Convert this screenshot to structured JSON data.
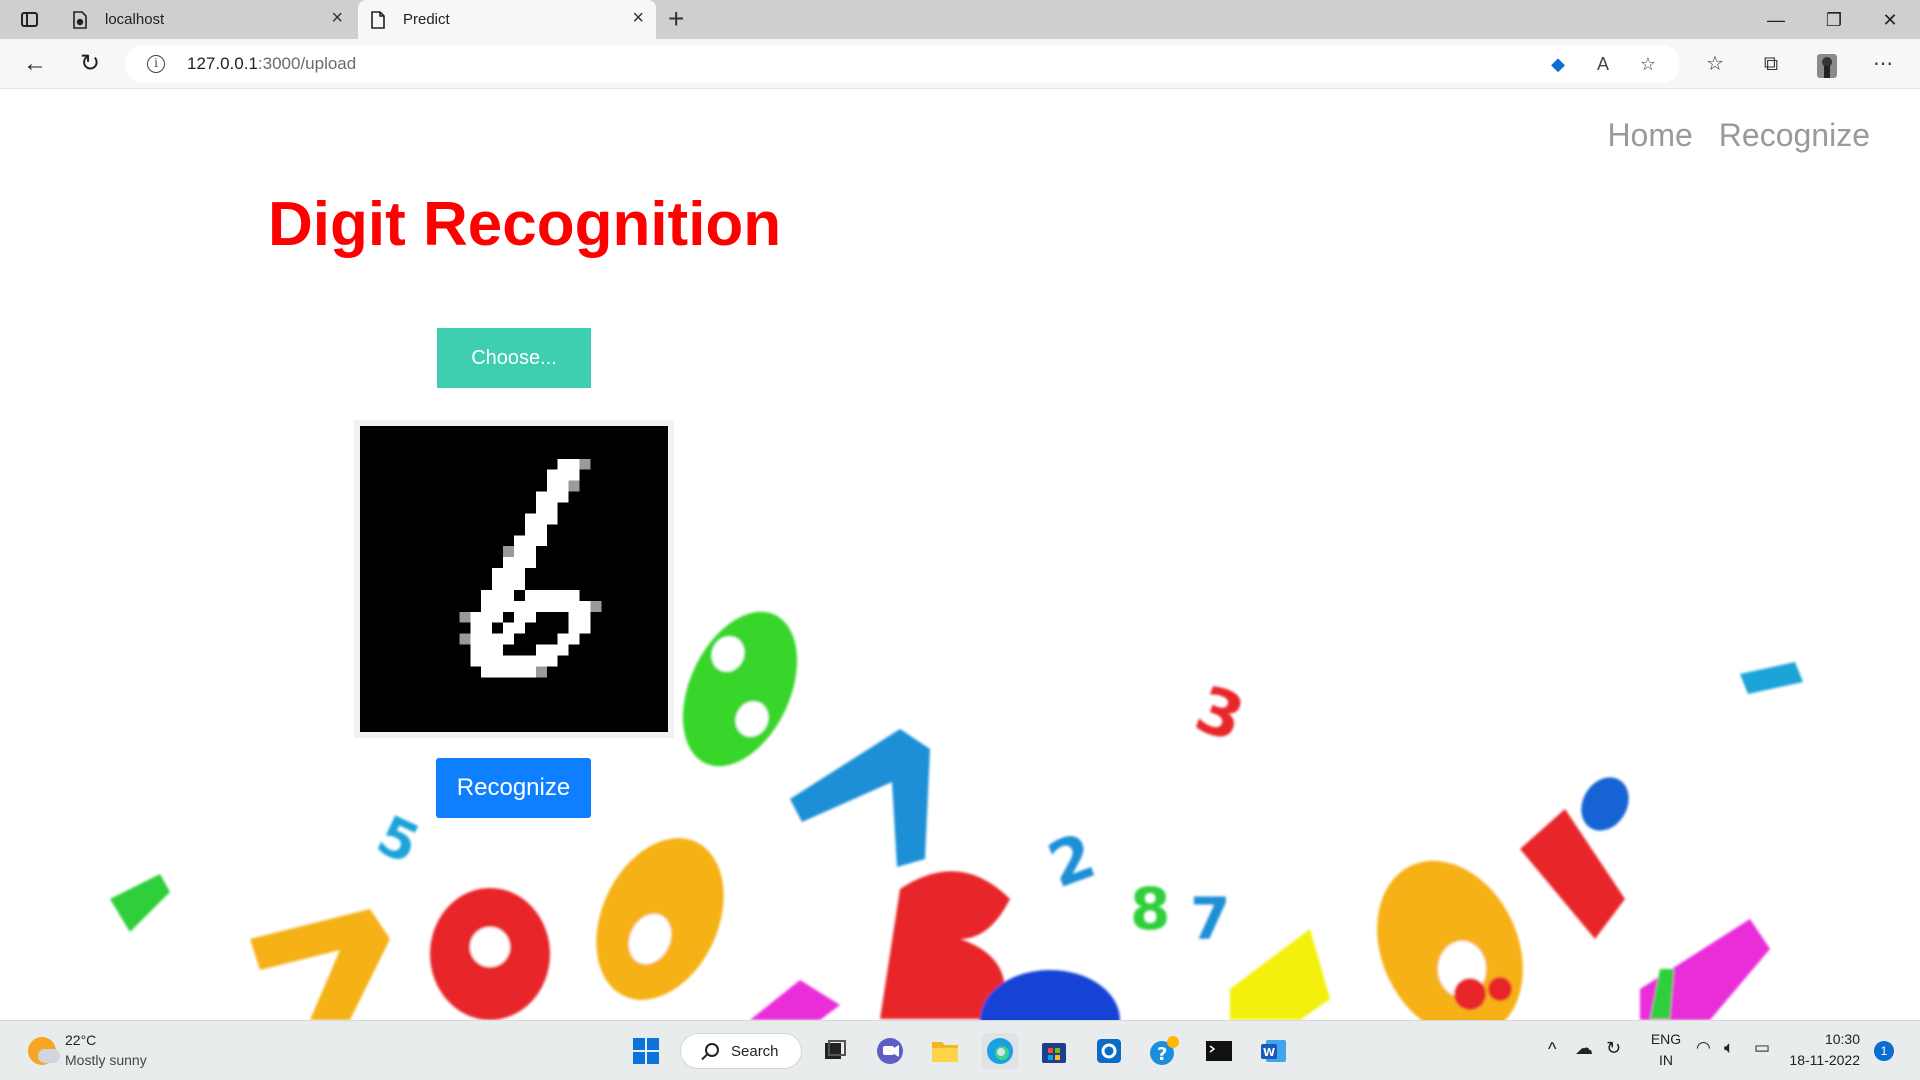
{
  "browser": {
    "tabs": [
      {
        "title": "localhost"
      },
      {
        "title": "Predict"
      }
    ],
    "url_host": "127.0.0.1",
    "url_path": ":3000/upload"
  },
  "site": {
    "nav": [
      {
        "label": "Home"
      },
      {
        "label": "Recognize"
      }
    ],
    "title": "Digit Recognition",
    "choose_label": "Choose...",
    "recognize_label": "Recognize"
  },
  "taskbar": {
    "temperature": "22°C",
    "weather": "Mostly sunny",
    "search_label": "Search",
    "language": "ENG",
    "region": "IN",
    "time": "10:30",
    "date": "18-11-2022",
    "notifications": "1"
  },
  "colors": {
    "title": "#ff0000",
    "choose_button": "#3ecfb0",
    "recognize_button": "#0d7fff"
  }
}
